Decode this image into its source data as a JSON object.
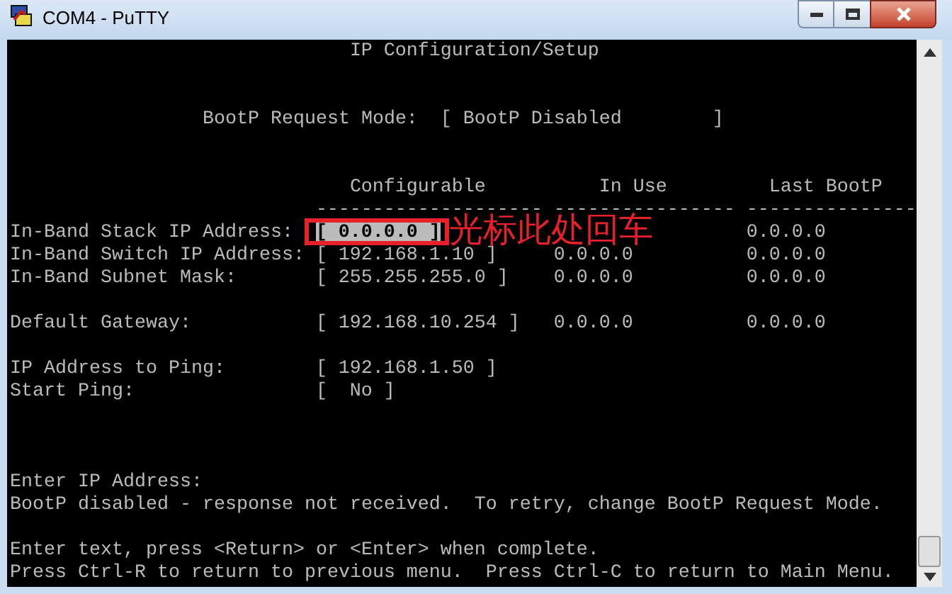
{
  "window": {
    "title": "COM4 - PuTTY"
  },
  "terminal": {
    "title": "IP Configuration/Setup",
    "bootp_mode": {
      "label": "BootP Request Mode:",
      "value": "[ BootP Disabled        ]"
    },
    "columns": [
      {
        "heading": "Configurable",
        "rule": "--------------------"
      },
      {
        "heading": "In Use",
        "rule": "----------------"
      },
      {
        "heading": "Last BootP",
        "rule": "---------------"
      }
    ],
    "groups": [
      [
        {
          "label": "In-Band Stack IP Address:",
          "configurable": "[ 0.0.0.0 ]",
          "selected": true,
          "last_bootp": "0.0.0.0"
        },
        {
          "label": "In-Band Switch IP Address:",
          "configurable": "[ 192.168.1.10 ]",
          "selected": false,
          "in_use": "0.0.0.0",
          "last_bootp": "0.0.0.0"
        },
        {
          "label": "In-Band Subnet Mask:",
          "configurable": "[ 255.255.255.0 ]",
          "selected": false,
          "in_use": "0.0.0.0",
          "last_bootp": "0.0.0.0"
        }
      ],
      [
        {
          "label": "Default Gateway:",
          "configurable": "[ 192.168.10.254 ]",
          "selected": false,
          "in_use": "0.0.0.0",
          "last_bootp": "0.0.0.0"
        }
      ],
      [
        {
          "label": "IP Address to Ping:",
          "configurable": "[ 192.168.1.50 ]",
          "selected": false
        },
        {
          "label": "Start Ping:",
          "configurable": "[  No ]",
          "selected": false
        }
      ]
    ],
    "prompt": "Enter IP Address:",
    "status": "BootP disabled - response not received.  To retry, change BootP Request Mode.",
    "help": [
      "Enter text, press <Return> or <Enter> when complete.",
      "Press Ctrl-R to return to previous menu.  Press Ctrl-C to return to Main Menu."
    ]
  },
  "annotation": {
    "text": "光标此处回车"
  }
}
